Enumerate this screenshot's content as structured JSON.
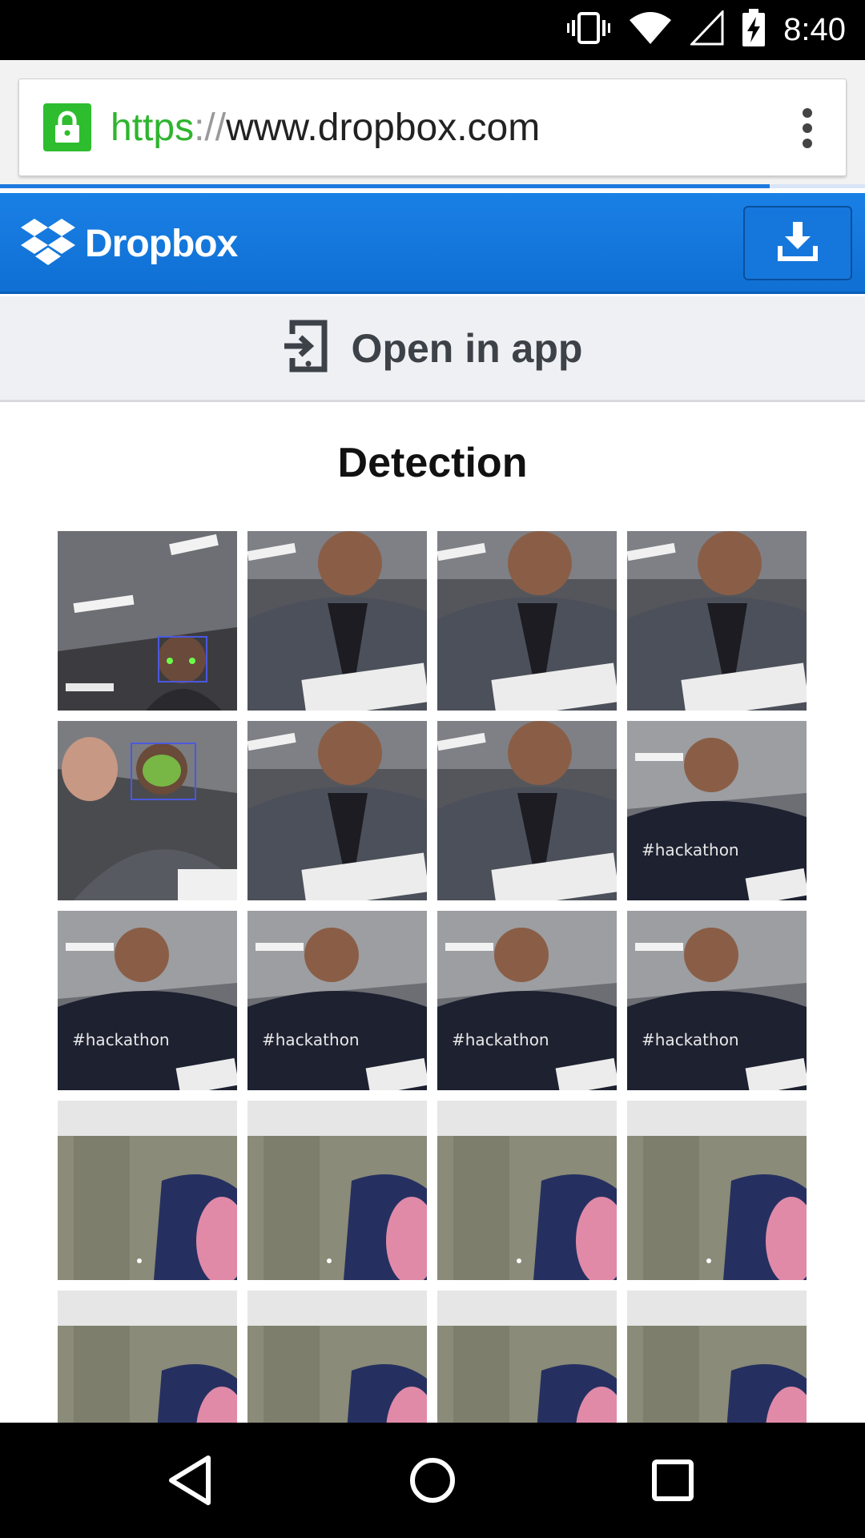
{
  "status_bar": {
    "time": "8:40",
    "icons": [
      "vibrate-icon",
      "wifi-icon",
      "cell-signal-icon",
      "battery-charging-icon"
    ]
  },
  "browser": {
    "url_scheme": "https",
    "url_separator": "://",
    "url_host": "www.dropbox.com",
    "lock_icon": "lock-icon",
    "menu_icon": "more-vert-icon",
    "load_progress": 0.89
  },
  "header": {
    "brand": "Dropbox",
    "logo_icon": "dropbox-logo-icon",
    "download_icon": "download-icon",
    "brand_color": "#1a80e6"
  },
  "open_in_app": {
    "label": "Open in app",
    "icon": "open-in-app-icon"
  },
  "page": {
    "title": "Detection"
  },
  "thumbnails": [
    {
      "scene": "ceiling-face-detected",
      "detected": true
    },
    {
      "scene": "man-checked-shirt"
    },
    {
      "scene": "man-checked-shirt"
    },
    {
      "scene": "man-checked-shirt"
    },
    {
      "scene": "man-waving-face-detected",
      "detected": true
    },
    {
      "scene": "man-checked-shirt"
    },
    {
      "scene": "man-checked-shirt"
    },
    {
      "scene": "man-black-tshirt",
      "text": "#hackathon"
    },
    {
      "scene": "man-black-tshirt",
      "text": "#hackathon"
    },
    {
      "scene": "man-black-tshirt",
      "text": "#hackathon"
    },
    {
      "scene": "man-black-tshirt",
      "text": "#hackathon"
    },
    {
      "scene": "man-black-tshirt",
      "text": "#hackathon"
    },
    {
      "scene": "empty-chair"
    },
    {
      "scene": "empty-chair"
    },
    {
      "scene": "empty-chair"
    },
    {
      "scene": "empty-chair"
    },
    {
      "scene": "empty-chair"
    },
    {
      "scene": "empty-chair"
    },
    {
      "scene": "empty-chair"
    },
    {
      "scene": "empty-chair"
    }
  ],
  "nav_bar": {
    "buttons": [
      "back-icon",
      "home-icon",
      "recents-icon"
    ]
  }
}
